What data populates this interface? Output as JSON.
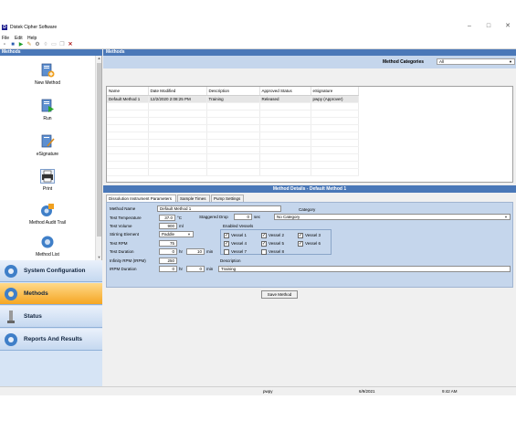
{
  "window": {
    "title": "Distek Cipher Software",
    "app_icon": "D"
  },
  "menu": {
    "items": [
      "File",
      "Edit",
      "Help"
    ]
  },
  "toolbar": {
    "icons": [
      "new-icon",
      "save-icon",
      "run-icon",
      "edit-icon",
      "settings-icon",
      "lock-icon",
      "print-icon",
      "copy-icon",
      "delete-icon"
    ]
  },
  "left": {
    "header": "Methods",
    "tools": [
      {
        "label": "New Method",
        "icon": "new-method-icon"
      },
      {
        "label": "Run",
        "icon": "run-icon"
      },
      {
        "label": "eSignature",
        "icon": "esignature-icon"
      },
      {
        "label": "Print",
        "icon": "print-icon"
      },
      {
        "label": "Method Audit Trail",
        "icon": "audit-trail-icon"
      },
      {
        "label": "Method List",
        "icon": "method-list-icon"
      }
    ],
    "nav": [
      {
        "label": "System Configuration",
        "icon": "gear-icon"
      },
      {
        "label": "Methods",
        "icon": "methods-icon"
      },
      {
        "label": "Status",
        "icon": "status-icon"
      },
      {
        "label": "Reports And Results",
        "icon": "reports-icon"
      }
    ],
    "active_nav": "Methods"
  },
  "main": {
    "header": "Methods",
    "category_label": "Method Categories",
    "category_value": "All"
  },
  "grid": {
    "columns": [
      "Name",
      "Date Modified",
      "Description",
      "Approved Status",
      "eSignature"
    ],
    "rows": [
      [
        "Default Method 1",
        "12/2/2020 2:08:25 PM",
        "Training",
        "Released",
        "pwpy (Approver)"
      ]
    ]
  },
  "details": {
    "header": "Method Details - Default Method 1",
    "tabs": [
      "Dissolution Instrument Parameters",
      "Sample Times",
      "Pump Settings"
    ],
    "method_name_label": "Method Name",
    "method_name": "Default Method 1",
    "category_label": "Category",
    "category_value": "No Category",
    "test_temp_label": "Test Temperature",
    "test_temp": "37.0",
    "test_temp_unit": "°C",
    "staggered_label": "Staggered Drop",
    "staggered_value": "0",
    "staggered_unit": "sec",
    "test_volume_label": "Test Volume",
    "test_volume": "900",
    "test_volume_unit": "ml",
    "enabled_vessels_label": "Enabled Vessels",
    "stirring_label": "Stirring Element",
    "stirring_value": "Paddle",
    "test_rpm_label": "Test RPM",
    "test_rpm": "75",
    "test_duration_label": "Test Duration",
    "test_duration_hr": "0",
    "test_duration_min": "10",
    "hr_unit": "hr",
    "min_unit": "min",
    "infinity_rpm_label": "Infinity RPM (IRPM)",
    "infinity_rpm": "250",
    "irpm_duration_label": "IRPM Duration",
    "irpm_duration_hr": "0",
    "irpm_duration_min": "0",
    "description_label": "Description",
    "description": "Training",
    "vessels": [
      {
        "label": "Vessel 1",
        "checked": true
      },
      {
        "label": "Vessel 2",
        "checked": true
      },
      {
        "label": "Vessel 3",
        "checked": true
      },
      {
        "label": "Vessel 4",
        "checked": true
      },
      {
        "label": "Vessel 5",
        "checked": true
      },
      {
        "label": "Vessel 6",
        "checked": true
      },
      {
        "label": "Vessel 7",
        "checked": false
      },
      {
        "label": "Vessel 8",
        "checked": false
      }
    ],
    "save_label": "Save Method"
  },
  "status": {
    "user": "pwpy",
    "date": "6/9/2021",
    "time": "9:42 AM"
  }
}
